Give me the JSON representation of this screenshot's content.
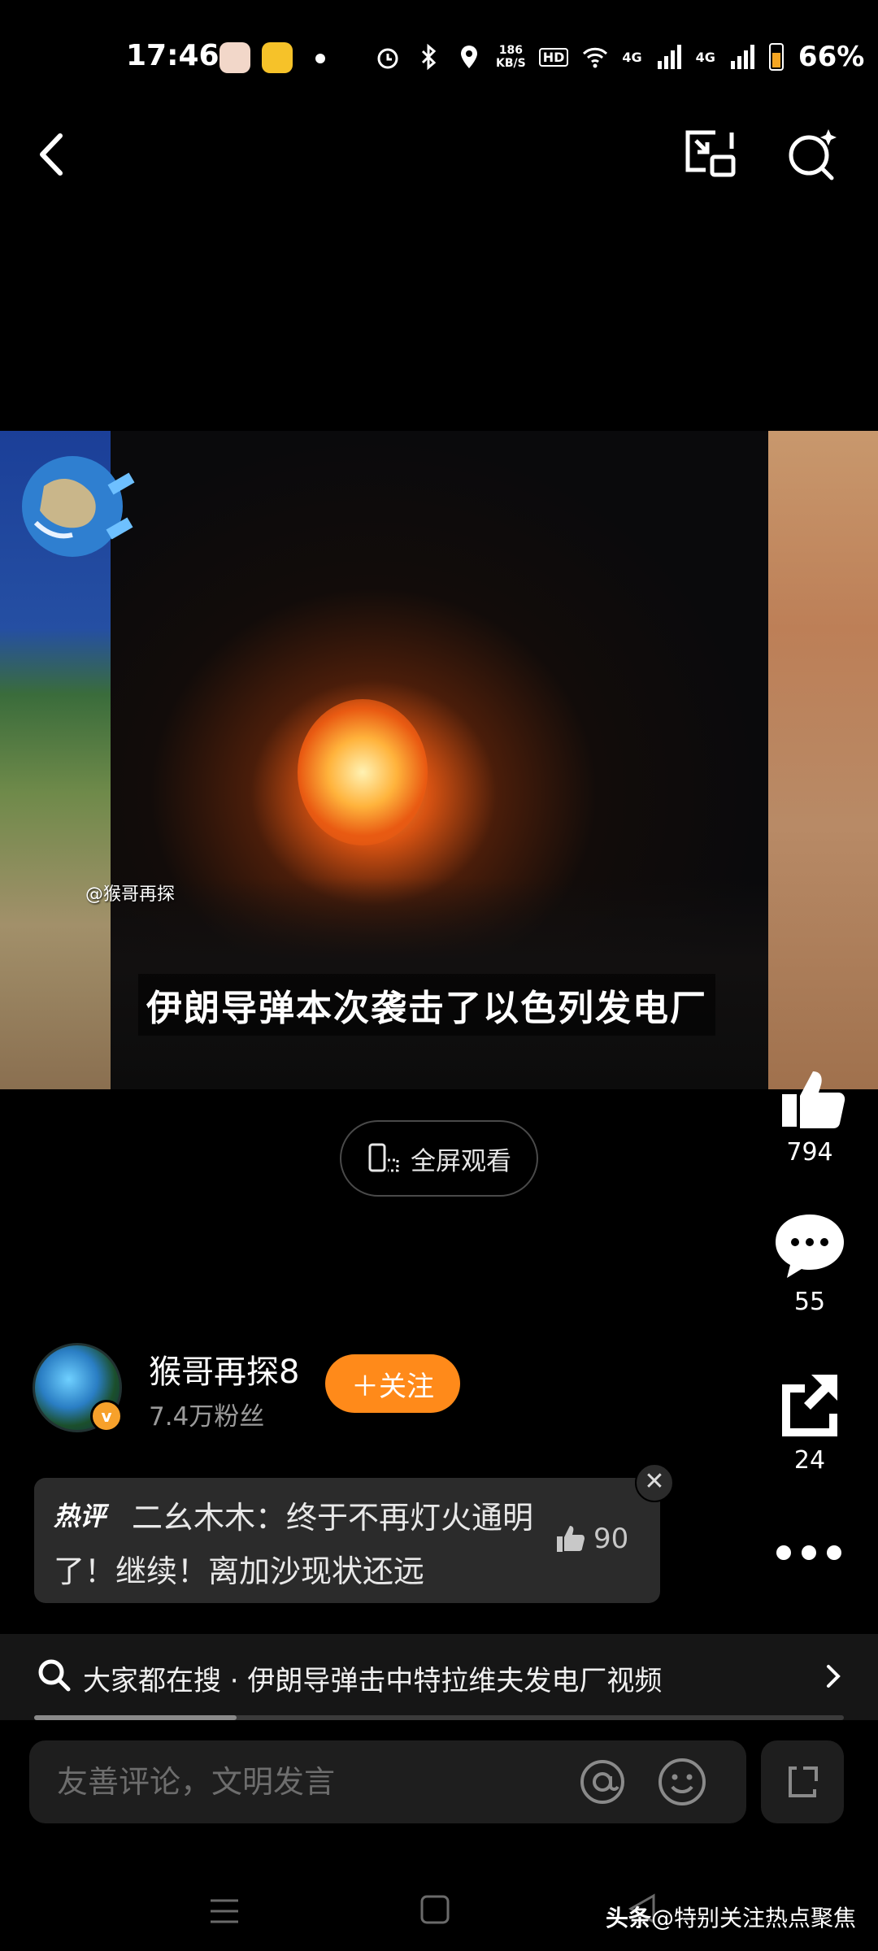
{
  "status_bar": {
    "time": "17:46",
    "net_speed_top": "186",
    "net_speed_unit": "KB/S",
    "hd": "HD",
    "signal1": "4G",
    "signal2": "4G",
    "battery": "66%"
  },
  "header": {
    "back_icon": "chevron-left-icon",
    "pip_icon": "picture-in-picture-icon",
    "search_icon": "search-sparkle-icon"
  },
  "video": {
    "watermark": "@猴哥再探",
    "subtitle": "伊朗导弹本次袭击了以色列发电厂"
  },
  "fullscreen_label": "全屏观看",
  "actions": {
    "likes": "794",
    "comments": "55",
    "shares": "24"
  },
  "author": {
    "name": "猴哥再探8",
    "fans": "7.4万粉丝",
    "verified_mark": "v",
    "follow_label": "＋关注"
  },
  "hot_comment": {
    "tag": "热评",
    "text": "二幺木木：终于不再灯火通明了！继续！离加沙现状还远",
    "likes": "90",
    "close": "✕"
  },
  "search_suggestion": {
    "text": "大家都在搜 · 伊朗导弹击中特拉维夫发电厂视频"
  },
  "progress": 0.25,
  "comment_input": {
    "placeholder": "友善评论，文明发言"
  },
  "footer": {
    "brand": "头条",
    "handle": "@特别关注热点聚焦"
  },
  "colors": {
    "accent": "#ff8a1a",
    "background": "#000000",
    "card": "#2b2b2b"
  }
}
